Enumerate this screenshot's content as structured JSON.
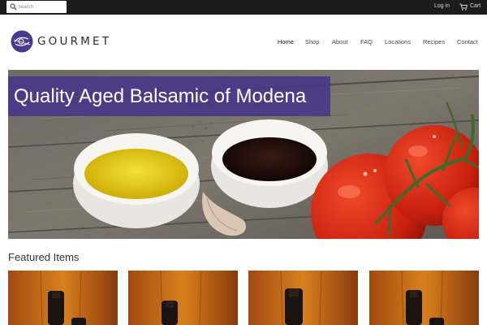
{
  "topbar": {
    "search_placeholder": "Search",
    "search_icon": "search-icon",
    "login_label": "Log in",
    "cart_label": "Cart",
    "cart_icon": "cart-icon"
  },
  "brand": {
    "name": "GOURMET",
    "accent_color": "#4a3a8c"
  },
  "nav": {
    "items": [
      {
        "label": "Home",
        "active": true
      },
      {
        "label": "Shop"
      },
      {
        "label": "About"
      },
      {
        "label": "FAQ"
      },
      {
        "label": "Locations"
      },
      {
        "label": "Recipes"
      },
      {
        "label": "Contact"
      }
    ]
  },
  "hero": {
    "title": "Quality Aged Balsamic of Modena",
    "banner_color": "#483888"
  },
  "featured": {
    "title": "Featured Items",
    "items": [
      {
        "image": "balsamic-bottle-product-image"
      },
      {
        "image": "balsamic-bottle-product-image"
      },
      {
        "image": "balsamic-bottle-product-image"
      },
      {
        "image": "balsamic-bottle-product-image"
      }
    ]
  }
}
